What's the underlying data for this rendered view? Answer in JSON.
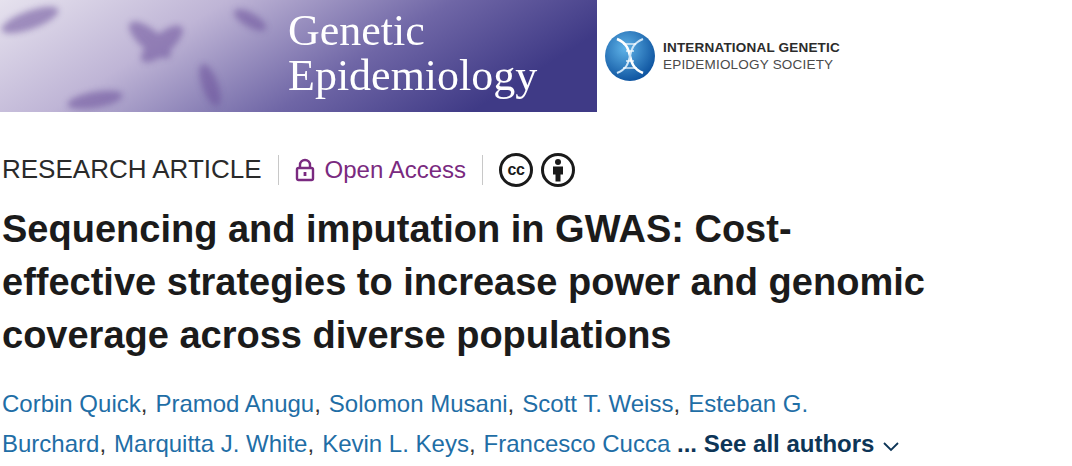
{
  "journal": {
    "name_lines": [
      "Genetic",
      "Epidemiology"
    ]
  },
  "society": {
    "lines": [
      "INTERNATIONAL GENETIC",
      "EPIDEMIOLOGY SOCIETY"
    ]
  },
  "article": {
    "type": "RESEARCH ARTICLE",
    "access": "Open Access",
    "license_text": "cc",
    "title_lines": [
      "Sequencing and imputation in GWAS: Cost-",
      "effective strategies to increase power and genomic",
      "coverage across diverse populations"
    ]
  },
  "authors": {
    "names": [
      "Corbin Quick",
      "Pramod Anugu",
      "Solomon Musani",
      "Scott T. Weiss",
      "Esteban G. Burchard",
      "Marquitta J. White",
      "Kevin L. Keys",
      "Francesco Cucca"
    ],
    "separator": ",",
    "more": "... See all authors",
    "expanded": false
  }
}
